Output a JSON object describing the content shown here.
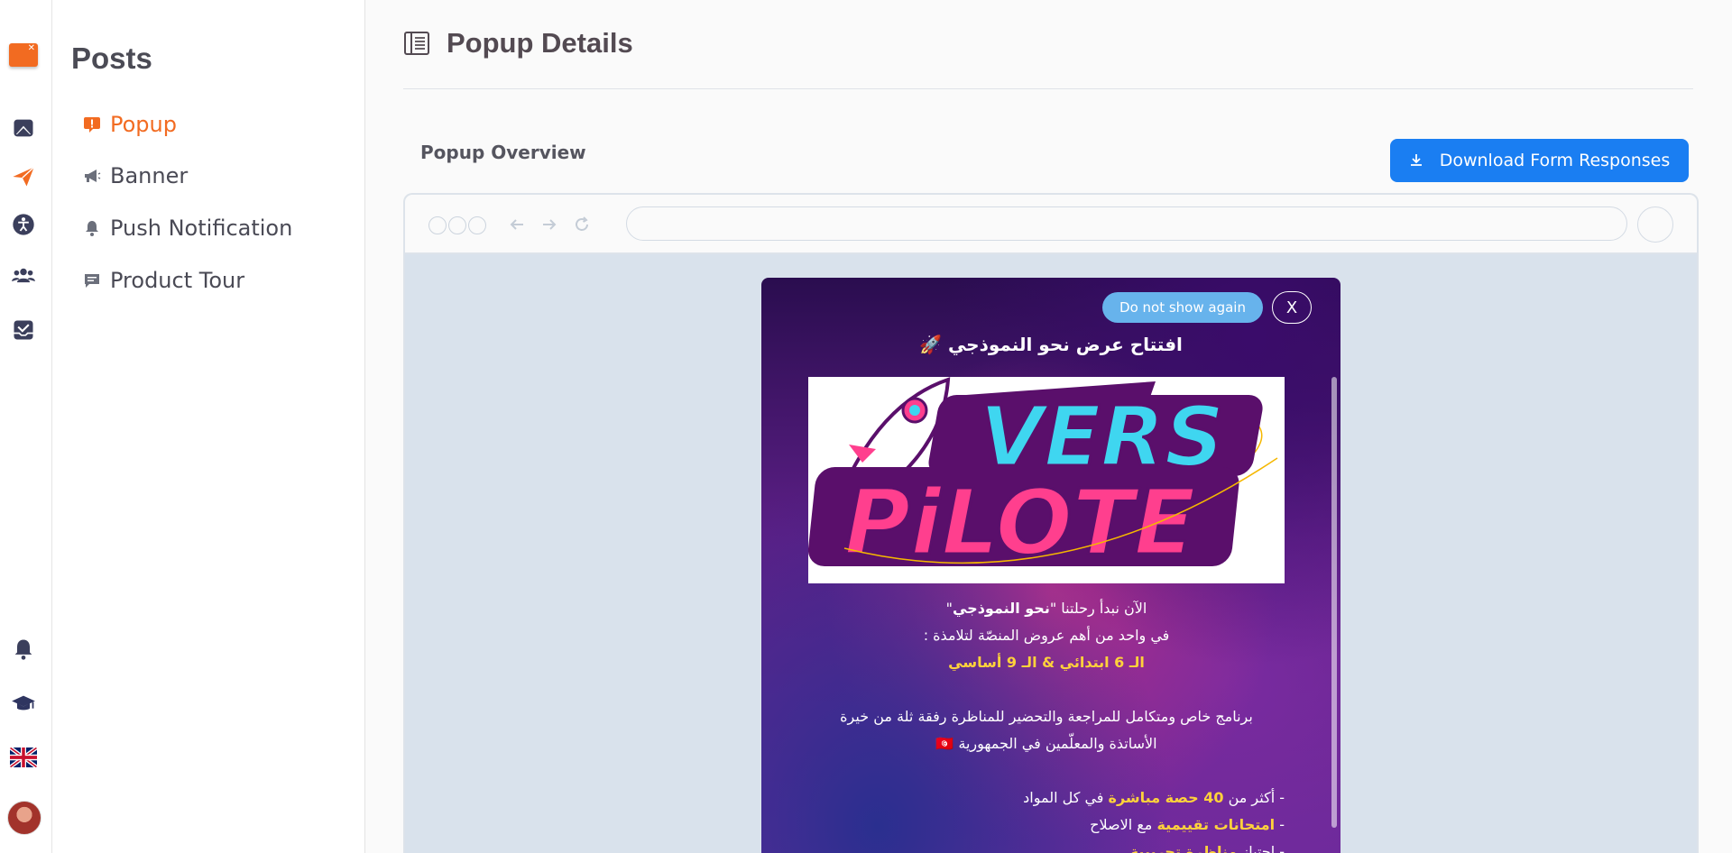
{
  "sidebar": {
    "title": "Posts",
    "items": [
      {
        "label": "Popup",
        "icon": "alert-icon"
      },
      {
        "label": "Banner",
        "icon": "megaphone-icon"
      },
      {
        "label": "Push Notification",
        "icon": "bell-icon"
      },
      {
        "label": "Product Tour",
        "icon": "chat-icon"
      }
    ]
  },
  "header": {
    "title": "Popup Details"
  },
  "overview": {
    "title": "Popup Overview",
    "download_label": "Download Form Responses"
  },
  "popup": {
    "dont_show_label": "Do not show again",
    "close_label": "X",
    "title": "افتتاح عرض نحو النموذجي 🚀",
    "banner_text_top": "VERS",
    "banner_text_bottom": "PiLOTE",
    "body": {
      "line1_pre": "الآن نبدأ رحلتنا \"",
      "line1_bold": "نحو النموذجي",
      "line1_post": "\"",
      "line2": "في واحد من أهم عروض المنصّة لتلامذة :",
      "line3": "الـ 6 ابتدائي & الـ 9 أساسي",
      "line4": "برنامج خاص ومتكامل للمراجعة والتحضير للمناظرة رفقة ثلة من خيرة",
      "line5": "الأساتذة والمعلّمين في الجمهورية 🇹🇳",
      "list1_pre": "- أكثر من ",
      "list1_bold": "40 حصة مباشرة",
      "list1_post": " في كل المواد",
      "list2_pre": "- ",
      "list2_bold": "امتحانات تقييمية",
      "list2_post": " مع الاصلاح",
      "list3_pre": "- اجتياز ",
      "list3_bold": "مناظرة تجريبية"
    }
  },
  "colors": {
    "accent": "#f26b21",
    "primary_button": "#1a7ef2",
    "popup_button": "#67b3ec",
    "highlight": "#ffd23b"
  }
}
